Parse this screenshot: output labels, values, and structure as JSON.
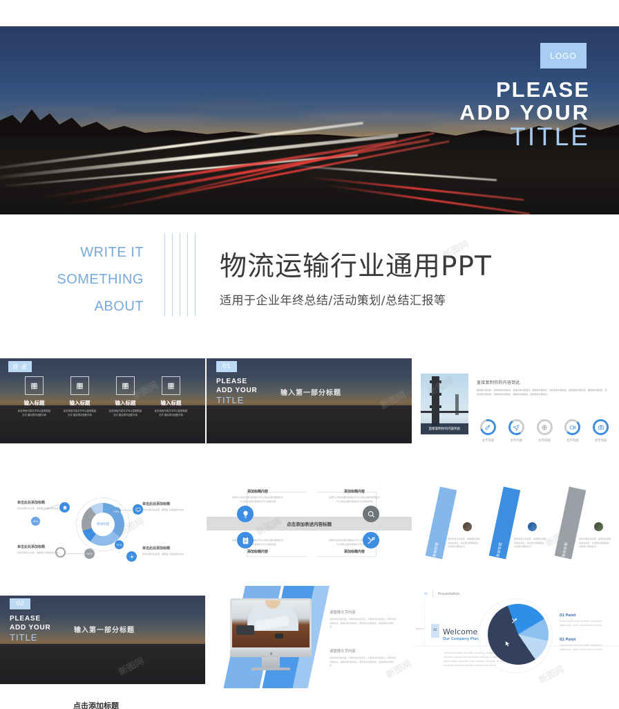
{
  "hero": {
    "logo": "LOGO",
    "title_line1": "PLEASE",
    "title_line2": "ADD  YOUR",
    "title_line3": "TITLE",
    "accent_color": "#a9cdf2"
  },
  "title_band": {
    "write_lines": [
      "WRITE IT",
      "SOMETHING",
      "ABOUT"
    ],
    "main_title": "物流运输行业通用PPT",
    "subtitle": "适用于企业年终总结/活动策划/总结汇报等",
    "accent_color": "#76aade"
  },
  "slides": {
    "toc": {
      "tag": "目  录",
      "items": [
        {
          "label": "输入标题",
          "icon": "building-icon",
          "desc": "此处添加内容文字可以复制粘贴文字\n建议再次适配字体"
        },
        {
          "label": "输入标题",
          "icon": "building-icon",
          "desc": "此处添加内容文字可以复制粘贴文字\n建议再次适配字体"
        },
        {
          "label": "输入标题",
          "icon": "building-icon",
          "desc": "此处添加内容文字可以复制粘贴文字\n建议再次适配字体"
        },
        {
          "label": "输入标题",
          "icon": "building-icon",
          "desc": "此处添加内容文字可以复制粘贴文字\n建议再次适配字体"
        }
      ]
    },
    "section_01": {
      "number": "01",
      "line1": "PLEASE",
      "line2": "ADD  YOUR",
      "line3": "TITLE",
      "cn_title": "输入第一部分标题"
    },
    "bridge": {
      "caption": "直接复制你的内容到此",
      "heading": "直接复制你的内容到此",
      "body": "据复制内容到此，直接复制内容到此，直接复制内容到此，据复制内容到此，直接复制内容到此，直接复制内容到此，据复制内容到此，直接复制内容到此，直接复制内容到此，据复制内容到此，直接复制内容到此。",
      "icons": [
        {
          "label": "文字内容",
          "icon": "rocket-icon",
          "progress": 70,
          "color": "#3d8ee0"
        },
        {
          "label": "文字内容",
          "icon": "paper-plane-icon",
          "progress": 45,
          "color": "#3d8ee0"
        },
        {
          "label": "文字内容",
          "icon": "globe-icon",
          "progress": 0,
          "color": "#9aa0a6"
        },
        {
          "label": "文字内容",
          "icon": "video-icon",
          "progress": 50,
          "color": "#3d8ee0"
        },
        {
          "label": "文字内容",
          "icon": "camera-icon",
          "progress": 80,
          "color": "#3d8ee0"
        }
      ]
    },
    "donut": {
      "center_label": "添加标题",
      "segments": [
        {
          "value": "35%",
          "color": "#6aa5e0"
        },
        {
          "value": "25%",
          "color": "#6aa5e0"
        },
        {
          "value": "10%",
          "color": "#3d8ee0"
        },
        {
          "value": "20%",
          "color": "#9aa0a6"
        }
      ],
      "labels": [
        {
          "title": "单击此处添加标题",
          "desc": "您的内容打在这里，或者通\n过复制您的文本。",
          "icon": "home-icon"
        },
        {
          "title": "单击此处添加标题",
          "desc": "您的内容打在这里，或者通\n过复制您的文本。",
          "icon": "monitor-icon"
        },
        {
          "title": "单击此处添加标题",
          "desc": "您的内容打在这里，或者通\n过复制您的文本。",
          "icon": "circle-icon"
        },
        {
          "title": "单击此处添加标题",
          "desc": "您的内容打在这里，或者通\n过复制您的文本。",
          "icon": "gear-icon"
        }
      ]
    },
    "process": {
      "bar_text": "点击添加表述内容标题",
      "boxes": [
        {
          "title": "添加标题内容",
          "desc": "这里可以添加主要内容或文字可以添加主要内容或文字可以添加主要内容或文字可以添加内容"
        },
        {
          "title": "添加标题内容",
          "desc": "这里可以添加主要内容或文字可以添加主要内容或文字可以添加主要内容或文字可以添加内容"
        },
        {
          "title": "添加标题内容",
          "desc": "这里可以添加主要内容或文字可以添加主要内容或文字可以添加主要内容或文字可以添加内容"
        },
        {
          "title": "添加标题内容",
          "desc": "这里可以添加主要内容或文字可以添加主要内容或文字可以添加主要内容或文字可以添加内容"
        }
      ],
      "icons": [
        "lightbulb-icon",
        "magnifier-icon",
        "clipboard-icon",
        "tools-icon"
      ]
    },
    "slant": {
      "bars": [
        {
          "label": "添加标题",
          "color": "#86b7ea",
          "text": "您的内容打在这里，或者通过复制您的文本后，在此框中选择粘贴，并选择只保留文字。"
        },
        {
          "label": "添加标题",
          "color": "#3d8ee0",
          "text": "您的内容打在这里，或者通过复制您的文本后，在此框中选择粘贴，并选择只保留文字。"
        },
        {
          "label": "添加标题",
          "color": "#9aa0a6",
          "text": "您的内容打在这里，或者通过复制您的文本后，在此框中选择粘贴，并选择只保留文字。"
        }
      ]
    },
    "section_02": {
      "number": "02",
      "line1": "PLEASE",
      "line2": "ADD  YOUR",
      "line3": "TITLE",
      "cn_title": "输入第一部分标题"
    },
    "imac": {
      "blocks": [
        {
          "title": "请替换文字内容",
          "desc": "复制你的内容到此，复制你的内容到此，复制你的内容到此，复制你的内容到此，复制你的内容到此，复制你的内容到此，复制你的内容到此。"
        },
        {
          "title": "请替换文字内容",
          "desc": "复制你的内容到此，复制你的内容到此，复制你的内容到此，复制你的内容到此，复制你的内容到此，复制你的内容到此，复制你的内容到此。"
        }
      ]
    },
    "pie": {
      "header_num": "01",
      "header_label": "Presentation",
      "about": "Ajency",
      "badge": "01",
      "welcome": "Welcome",
      "sub": "Our Company Plan",
      "body": "Lorem ipsum dolor sit amet, consetetur sadipscing elitr, sed diam nonumy eirmod tempor invidunt ut labore et dolore magna aliquyam erat, sed diam voluptua. At vero eos et accusam et justo duo dolores et ea rebum.",
      "points": [
        {
          "title": "01 Point",
          "desc": "Lorem ipsum dolor sit amet, consetetur sadipscing. Lorem ipsum dolor sit amet."
        },
        {
          "title": "02 Point",
          "desc": "Lorem ipsum dolor sit amet, consetetur sadipscing. Lorem ipsum dolor sit amet."
        }
      ]
    }
  },
  "bottom_cut_text": "点击添加标题",
  "watermark": "新图网"
}
